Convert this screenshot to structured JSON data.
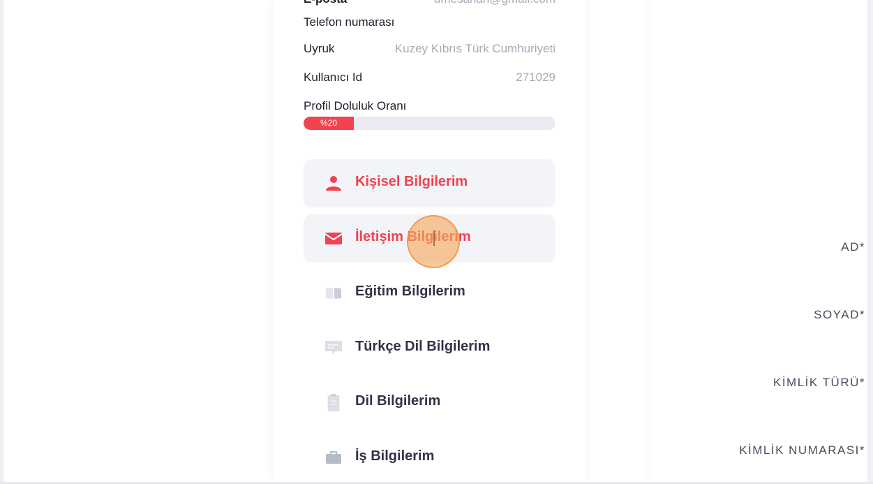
{
  "profile": {
    "email_label": "E-posta",
    "email_value": "umesahan@gmail.com",
    "phone_label": "Telefon numarası",
    "nationality_label": "Uyruk",
    "nationality_value": "Kuzey Kıbrıs Türk Cumhuriyeti",
    "user_id_label": "Kullanıcı Id",
    "user_id_value": "271029",
    "completion_label": "Profil Doluluk Oranı",
    "completion_text": "%20",
    "completion_percent": 20
  },
  "menu": {
    "items": [
      {
        "label": "Kişisel Bilgilerim",
        "icon": "person-icon"
      },
      {
        "label": "İletişim Bilgilerim",
        "icon": "mail-icon"
      },
      {
        "label": "Eğitim Bilgilerim",
        "icon": "book-icon"
      },
      {
        "label": "Türkçe Dil Bilgilerim",
        "icon": "chat-icon"
      },
      {
        "label": "Dil Bilgilerim",
        "icon": "clipboard-icon"
      },
      {
        "label": "İş Bilgilerim",
        "icon": "briefcase-icon"
      }
    ]
  },
  "form": {
    "first_name_label": "AD*",
    "last_name_label": "SOYAD*",
    "id_type_label": "KİMLİK TÜRÜ*",
    "id_number_label": "KİMLİK NUMARASI*"
  },
  "colors": {
    "accent": "#f0434f",
    "muted_icon": "#d5d9e1",
    "page_bg": "#f2f3f7",
    "click_indicator": "#f7a85c"
  }
}
